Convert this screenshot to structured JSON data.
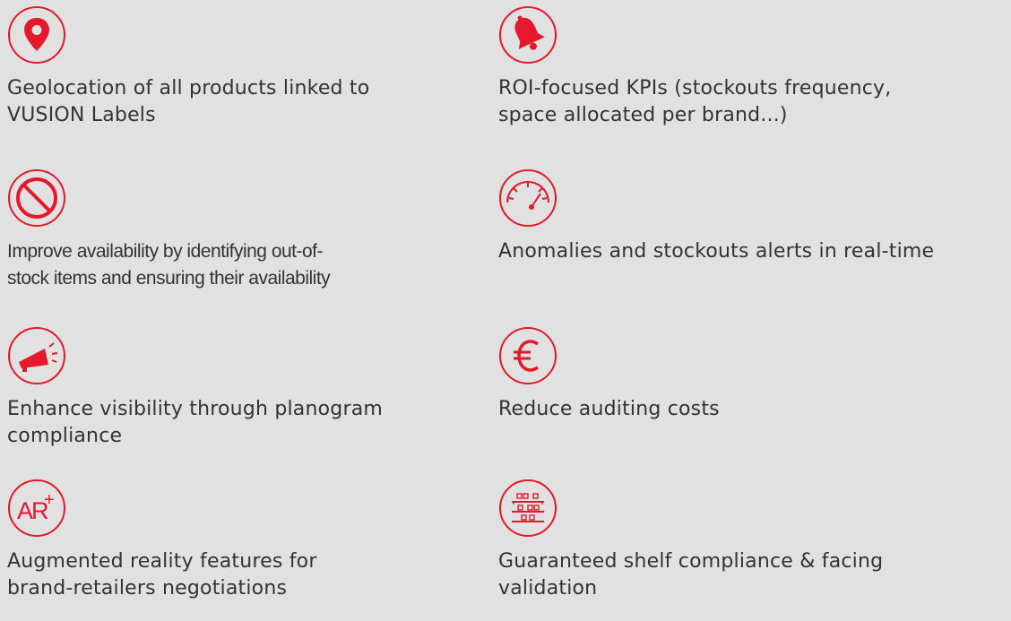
{
  "theme": {
    "background": "#e1e1e1",
    "accent": "#e6182c",
    "text": "#333333"
  },
  "features": [
    {
      "icon": "location-pin-icon",
      "label": "Geolocation of all products linked to\nVUSION Labels"
    },
    {
      "icon": "bell-icon",
      "label": "ROI-focused KPIs (stockouts frequency,\nspace allocated per brand...)"
    },
    {
      "icon": "prohibited-icon",
      "label": "Improve availability by identifying out-of-\nstock items and ensuring their availability"
    },
    {
      "icon": "speedometer-icon",
      "label": "Anomalies and stockouts alerts in real-time"
    },
    {
      "icon": "megaphone-icon",
      "label": "Enhance visibility through planogram\ncompliance"
    },
    {
      "icon": "euro-icon",
      "label": "Reduce auditing costs"
    },
    {
      "icon": "ar-plus-icon",
      "label": "Augmented reality features for\nbrand-retailers negotiations",
      "icon_text": "AR",
      "icon_sup": "+"
    },
    {
      "icon": "shelf-icon",
      "label": "Guaranteed shelf compliance & facing\nvalidation"
    }
  ]
}
